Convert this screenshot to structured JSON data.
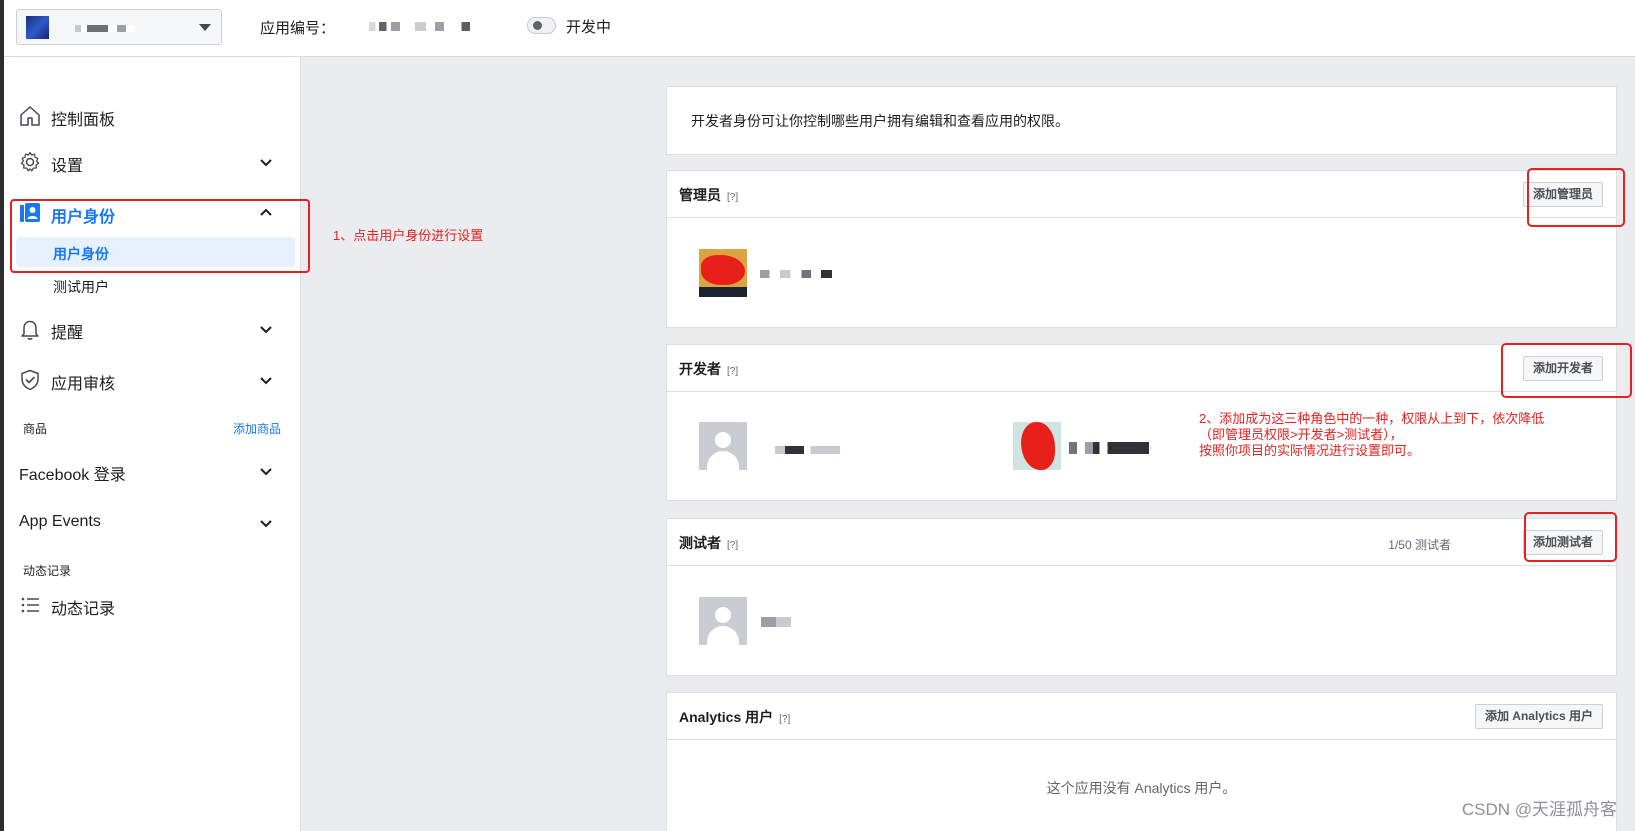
{
  "topbar": {
    "app_id_label": "应用编号：",
    "dev_status": "开发中"
  },
  "sidebar": {
    "items": [
      {
        "label": "控制面板",
        "icon": "home-icon"
      },
      {
        "label": "设置",
        "icon": "gear-icon"
      },
      {
        "label": "用户身份",
        "icon": "roles-icon",
        "active": true
      },
      {
        "label": "提醒",
        "icon": "bell-icon"
      },
      {
        "label": "应用审核",
        "icon": "shield-check-icon"
      },
      {
        "label": "Facebook 登录"
      },
      {
        "label": "App Events"
      },
      {
        "label": "动态记录",
        "icon": "list-icon"
      }
    ],
    "subitems": [
      "用户身份",
      "测试用户"
    ],
    "products_label": "商品",
    "add_product_link": "添加商品",
    "activity_section_label": "动态记录"
  },
  "main": {
    "intro": "开发者身份可让你控制哪些用户拥有编辑和查看应用的权限。",
    "help_marker": "[?]",
    "admins": {
      "title": "管理员",
      "button": "添加管理员"
    },
    "developers": {
      "title": "开发者",
      "button": "添加开发者"
    },
    "testers": {
      "title": "测试者",
      "button": "添加测试者",
      "count": "1/50 测试者"
    },
    "analytics": {
      "title": "Analytics 用户",
      "button": "添加 Analytics 用户",
      "empty": "这个应用没有 Analytics 用户。"
    }
  },
  "annotations": {
    "step1": "1、点击用户身份进行设置",
    "step2_lines": [
      "2、添加成为这三种角色中的一种，权限从上到下，依次降低",
      "（即管理员权限>开发者>测试者），",
      "按照你项目的实际情况进行设置即可。"
    ]
  },
  "watermark": "CSDN @天涯孤舟客",
  "colors": {
    "accent": "#1877f2",
    "annotation": "#e52222"
  }
}
